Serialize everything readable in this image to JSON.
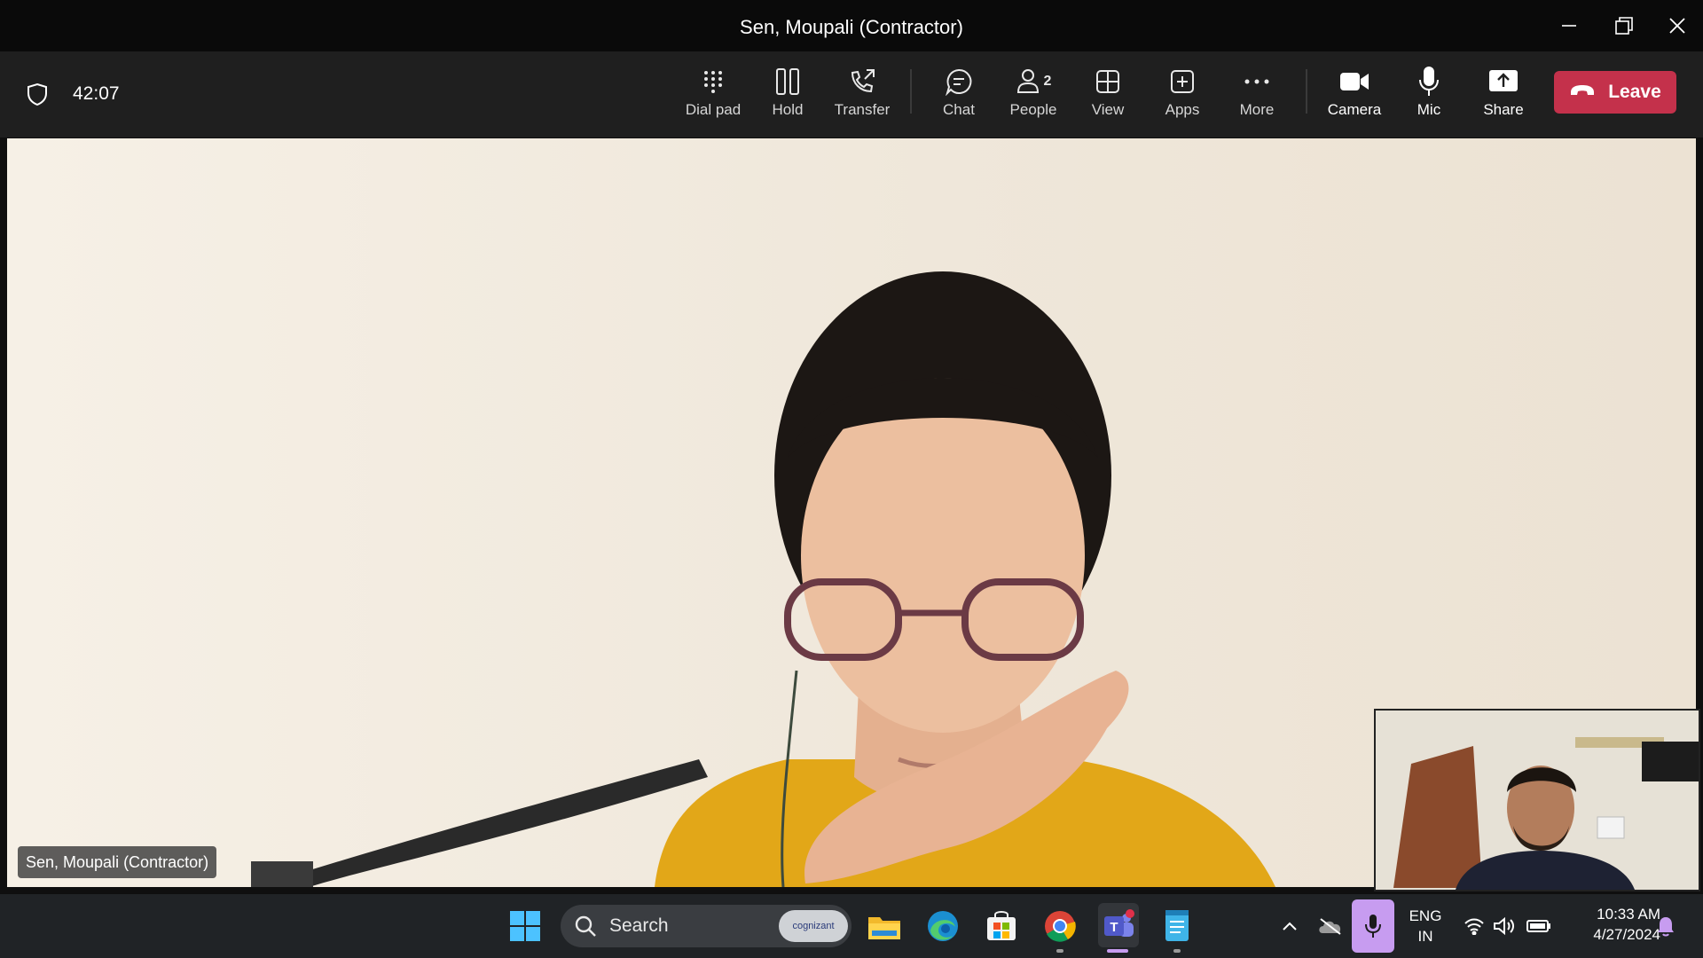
{
  "window": {
    "title": "Sen, Moupali (Contractor)",
    "controls": [
      "minimize-icon",
      "restore-icon",
      "close-icon"
    ]
  },
  "toolbar": {
    "timer": "42:07",
    "buttons": [
      {
        "label": "Dial pad",
        "icon": "dial-pad-icon"
      },
      {
        "label": "Hold",
        "icon": "hold-icon"
      },
      {
        "label": "Transfer",
        "icon": "transfer-icon"
      },
      {
        "label": "Chat",
        "icon": "chat-icon"
      },
      {
        "label": "People",
        "icon": "people-icon",
        "count": "2"
      },
      {
        "label": "View",
        "icon": "view-icon"
      },
      {
        "label": "Apps",
        "icon": "apps-icon"
      },
      {
        "label": "More",
        "icon": "more-icon"
      },
      {
        "label": "Camera",
        "icon": "camera-icon"
      },
      {
        "label": "Mic",
        "icon": "mic-icon"
      },
      {
        "label": "Share",
        "icon": "share-icon"
      }
    ],
    "leave_label": "Leave"
  },
  "stage": {
    "participant_name": "Sen, Moupali (Contractor)"
  },
  "taskbar": {
    "search_label": "Search",
    "search_badge": "cognizant",
    "pinned": [
      "windows-start-icon",
      "file-explorer-icon",
      "edge-icon",
      "store-icon",
      "chrome-icon",
      "teams-icon",
      "notepad-icon"
    ],
    "language": {
      "line1": "ENG",
      "line2": "IN"
    },
    "clock": {
      "time": "10:33 AM",
      "date": "4/27/2024"
    }
  },
  "colors": {
    "leave": "#c4314b",
    "toolbar": "#1f1f1f",
    "taskbar": "#202326",
    "mic_active": "#c79cf0"
  }
}
